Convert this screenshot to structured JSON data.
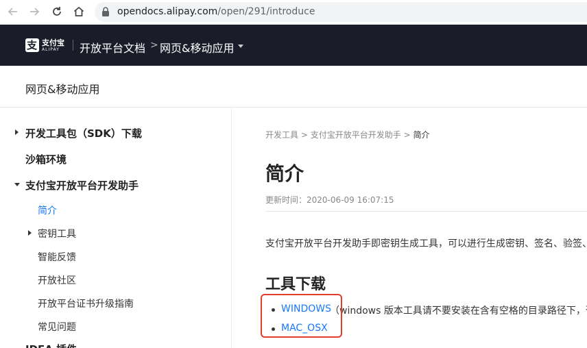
{
  "browser": {
    "url_host": "opendocs.alipay.com",
    "url_path": "/open/291/introduce"
  },
  "header": {
    "logo_cn": "支付宝",
    "logo_en": "ALIPAY",
    "title": "开放平台文档",
    "separator": ">",
    "product": "网页&移动应用"
  },
  "section": {
    "title": "网页&移动应用"
  },
  "sidebar": {
    "items": [
      {
        "label": "开发工具包（SDK）下载"
      },
      {
        "label": "沙箱环境"
      },
      {
        "label": "支付宝开放平台开发助手"
      },
      {
        "label": "简介"
      },
      {
        "label": "密钥工具"
      },
      {
        "label": "智能反馈"
      },
      {
        "label": "开放社区"
      },
      {
        "label": "开放平台证书升级指南"
      },
      {
        "label": "常见问题"
      },
      {
        "label": "IDEA 插件"
      }
    ]
  },
  "content": {
    "breadcrumb": {
      "part1": "开发工具",
      "sep": ">",
      "part2": "支付宝开放平台开发助手",
      "current": "简介"
    },
    "title": "简介",
    "updated_label": "更新时间：",
    "updated_value": "2020-06-09 16:07:15",
    "intro": "支付宝开放平台开发助手即密钥生成工具，可以进行生成密钥、签名、验签、",
    "downloads_heading": "工具下载",
    "downloads": [
      {
        "link": "WINDOWS",
        "note": "（windows 版本工具请不要安装在含有空格的目录路径下，否"
      },
      {
        "link": "MAC_OSX",
        "note": ""
      }
    ]
  }
}
